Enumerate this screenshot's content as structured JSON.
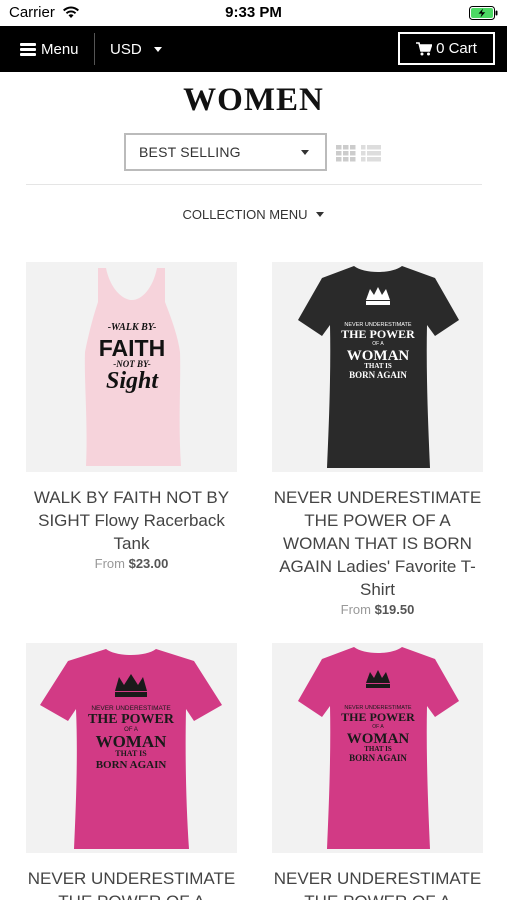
{
  "status_bar": {
    "carrier": "Carrier",
    "time": "9:33 PM"
  },
  "nav": {
    "menu_label": "Menu",
    "currency": "USD",
    "cart_label": "0 Cart"
  },
  "page": {
    "title": "WOMEN"
  },
  "sort": {
    "selected": "BEST SELLING"
  },
  "collection_menu_label": "COLLECTION MENU",
  "products": [
    {
      "title": "WALK BY FAITH NOT BY SIGHT Flowy Racerback Tank",
      "price_prefix": "From",
      "price": "$23.00",
      "shirt_color": "#f6d3db",
      "print_color": "#111111"
    },
    {
      "title": "NEVER UNDERESTIMATE THE POWER OF A WOMAN THAT IS BORN AGAIN Ladies' Favorite T-Shirt",
      "price_prefix": "From",
      "price": "$19.50",
      "shirt_color": "#2a2a2a",
      "print_color": "#ffffff"
    },
    {
      "title": "NEVER UNDERESTIMATE THE POWER OF A",
      "price_prefix": "",
      "price": "",
      "shirt_color": "#d23a85",
      "print_color": "#1a1a1a"
    },
    {
      "title": "NEVER UNDERESTIMATE THE POWER OF A",
      "price_prefix": "",
      "price": "",
      "shirt_color": "#d23a85",
      "print_color": "#1a1a1a"
    }
  ],
  "print_text": {
    "faith": [
      "-WALK BY-",
      "FAITH",
      "-NOT BY-",
      "Sight"
    ],
    "woman": [
      "NEVER UNDERESTIMATE",
      "THE POWER",
      "OF A",
      "WOMAN",
      "THAT IS",
      "BORN AGAIN"
    ]
  },
  "icons": {
    "wifi": "wifi-icon",
    "battery": "battery-charging-icon",
    "menu": "hamburger-icon",
    "cart": "cart-icon",
    "grid": "grid-view-icon",
    "list": "list-view-icon"
  }
}
